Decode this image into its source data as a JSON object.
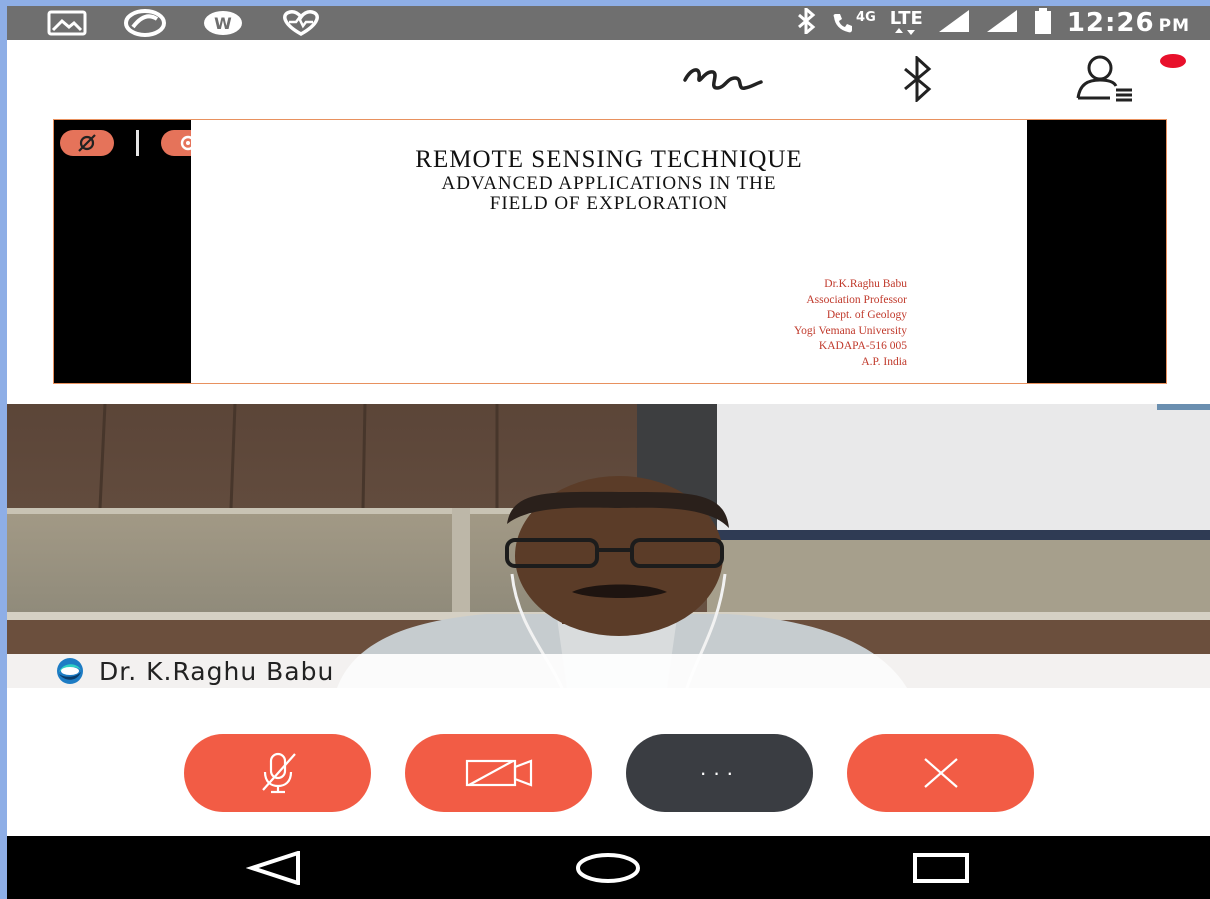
{
  "status_bar": {
    "left_icons": [
      "image-icon",
      "circle-app-icon",
      "whatsapp-icon",
      "heart-icon"
    ],
    "right_icons": [
      "bluetooth-icon",
      "volte-call-icon",
      "lte-signal-icon",
      "signal-icon",
      "signal-icon-2",
      "battery-icon"
    ],
    "net_4g": "4G",
    "lte": "LTE",
    "time": "12:26",
    "ampm": "PM"
  },
  "header": {
    "icons": [
      "annotate-icon",
      "bluetooth-icon",
      "participants-icon"
    ],
    "recording_indicator_color": "#e8102b"
  },
  "slide": {
    "title_line1": "REMOTE SENSING TECHNIQUE",
    "title_line2": "ADVANCED APPLICATIONS IN THE",
    "title_line3": "FIELD OF EXPLORATION",
    "author_lines": [
      "Dr.K.Raghu Babu",
      "Association Professor",
      "Dept. of Geology",
      "Yogi Vemana University",
      "KADAPA-516 005",
      "A.P. India"
    ],
    "share_controls": [
      "annotation-off-icon",
      "stop-share-icon"
    ]
  },
  "video": {
    "participant_name": "Dr. K.Raghu Babu"
  },
  "controls": {
    "buttons": [
      "mute-button",
      "video-off-button",
      "more-button",
      "leave-button"
    ],
    "more_label": "···",
    "accent": "#f25c45",
    "dark": "#3a3d42"
  },
  "nav": {
    "buttons": [
      "back-icon",
      "home-icon",
      "recents-icon"
    ]
  }
}
